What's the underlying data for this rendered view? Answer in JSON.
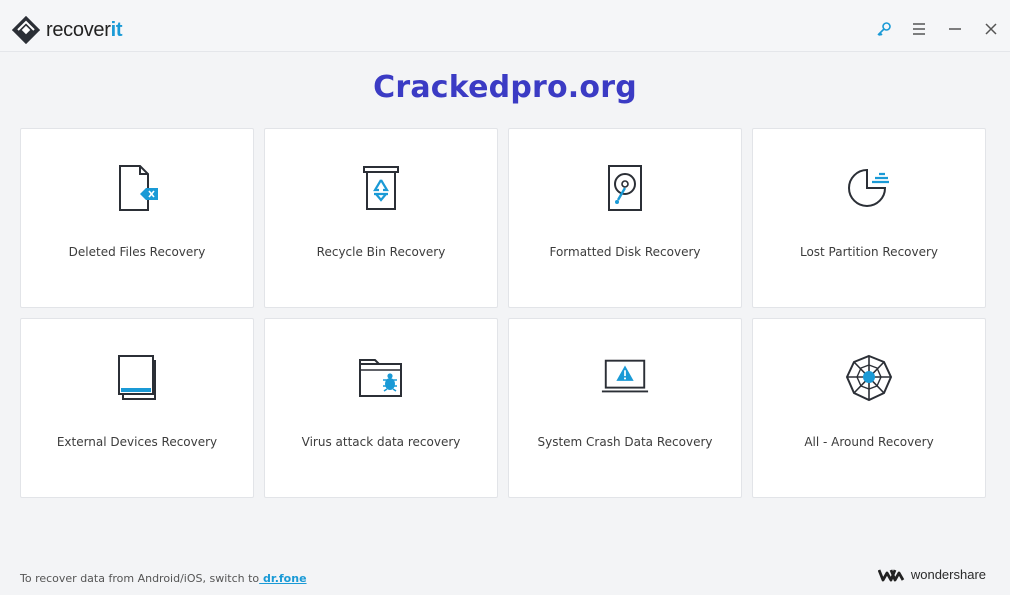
{
  "app": {
    "logo_text_regular": "recover",
    "logo_text_bold": "it",
    "accent_color": "#1a9ad6"
  },
  "window_controls": [
    {
      "name": "key-icon"
    },
    {
      "name": "menu-icon"
    },
    {
      "name": "minimize-icon"
    },
    {
      "name": "close-icon"
    }
  ],
  "watermark": "Crackedpro.org",
  "cards": [
    {
      "label": "Deleted Files Recovery",
      "icon": "deleted-file-icon"
    },
    {
      "label": "Recycle Bin Recovery",
      "icon": "recycle-bin-icon"
    },
    {
      "label": "Formatted Disk Recovery",
      "icon": "hard-disk-icon"
    },
    {
      "label": "Lost Partition Recovery",
      "icon": "partition-pie-icon"
    },
    {
      "label": "External Devices Recovery",
      "icon": "external-device-icon"
    },
    {
      "label": "Virus attack data recovery",
      "icon": "virus-folder-icon"
    },
    {
      "label": "System Crash Data Recovery",
      "icon": "crashed-laptop-icon"
    },
    {
      "label": "All - Around Recovery",
      "icon": "web-globe-icon"
    }
  ],
  "footer": {
    "text": "To recover data from Android/iOS, switch to",
    "link": " dr.fone",
    "brand": "wondershare"
  }
}
